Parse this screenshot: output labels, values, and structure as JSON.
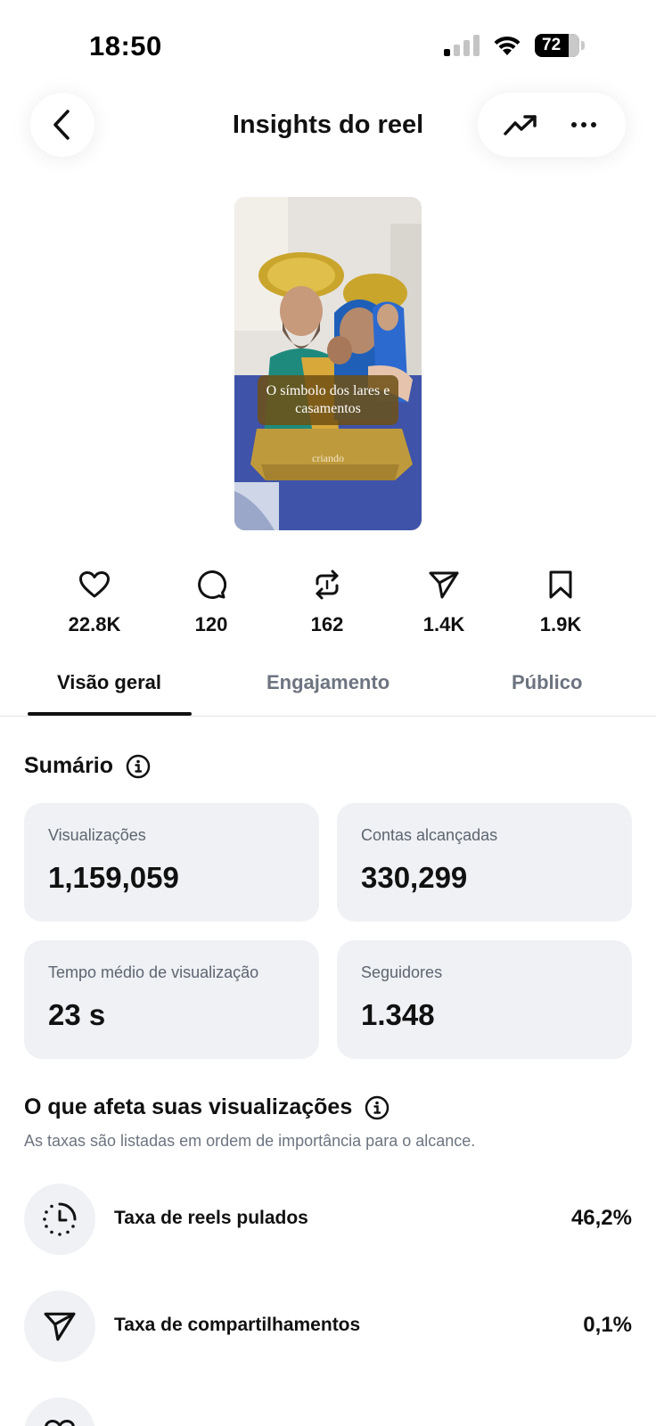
{
  "status": {
    "time": "18:50",
    "battery": "72"
  },
  "header": {
    "title": "Insights do reel"
  },
  "reel": {
    "caption": "O símbolo dos lares e casamentos",
    "subcaption": "criando"
  },
  "stats": [
    {
      "icon": "heart-icon",
      "value": "22.8K"
    },
    {
      "icon": "comment-icon",
      "value": "120"
    },
    {
      "icon": "repost-icon",
      "value": "162"
    },
    {
      "icon": "share-icon",
      "value": "1.4K"
    },
    {
      "icon": "bookmark-icon",
      "value": "1.9K"
    }
  ],
  "tabs": [
    {
      "label": "Visão geral",
      "active": true
    },
    {
      "label": "Engajamento",
      "active": false
    },
    {
      "label": "Público",
      "active": false
    }
  ],
  "summary": {
    "title": "Sumário",
    "cards": [
      {
        "label": "Visualizações",
        "value": "1,159,059"
      },
      {
        "label": "Contas alcançadas",
        "value": "330,299"
      },
      {
        "label": "Tempo médio de visualização",
        "value": "23 s"
      },
      {
        "label": "Seguidores",
        "value": "1.348"
      }
    ]
  },
  "affects": {
    "title": "O que afeta suas visualizações",
    "subtitle": "As taxas são listadas em ordem de importância para o alcance.",
    "rows": [
      {
        "icon": "skip-clock-icon",
        "label": "Taxa de reels pulados",
        "value": "46,2%"
      },
      {
        "icon": "share-icon",
        "label": "Taxa de compartilhamentos",
        "value": "0,1%"
      }
    ]
  }
}
